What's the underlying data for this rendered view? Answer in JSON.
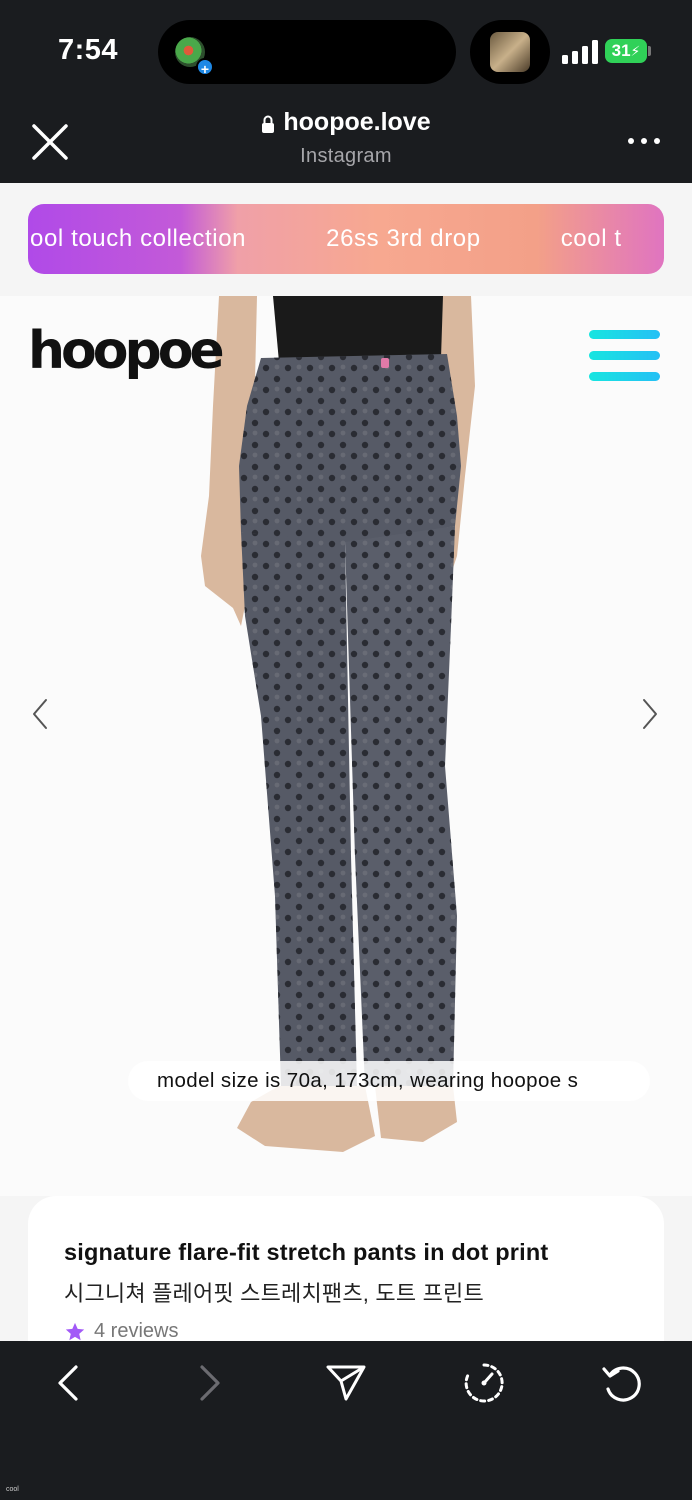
{
  "status_bar": {
    "time": "7:54",
    "battery": "31",
    "icons": [
      "app-activity-icon",
      "now-playing-artwork",
      "cellular-signal-icon",
      "battery-charging-icon"
    ]
  },
  "browser_header": {
    "domain": "hoopoe.love",
    "source_app": "Instagram",
    "close_icon": "close-icon",
    "more_icon": "more-options-icon",
    "lock_icon": "lock-icon"
  },
  "promo_banner": {
    "items": [
      "ool touch collection",
      "26ss 3rd drop",
      "cool t"
    ],
    "colors": {
      "start": "#b04ae8",
      "mid": "#f7a890",
      "end": "#e074c0"
    }
  },
  "site_header": {
    "logo": "hoopoe",
    "menu_icon": "hamburger-menu-icon",
    "menu_color": "#17e5e0"
  },
  "gallery": {
    "prev_icon": "chevron-left-icon",
    "next_icon": "chevron-right-icon",
    "caption": "model size is 70a, 173cm, wearing hoopoe s"
  },
  "product": {
    "title_en": "signature flare-fit stretch pants in dot print",
    "title_ko": "시그니쳐 플레어핏 스트레치팬츠, 도트 프린트",
    "reviews": "4 reviews",
    "star_color": "#a259f7"
  },
  "toolbar": {
    "buttons": [
      "back-icon",
      "forward-icon",
      "share-icon",
      "history-icon",
      "reload-icon"
    ]
  },
  "corner_label": "cool"
}
